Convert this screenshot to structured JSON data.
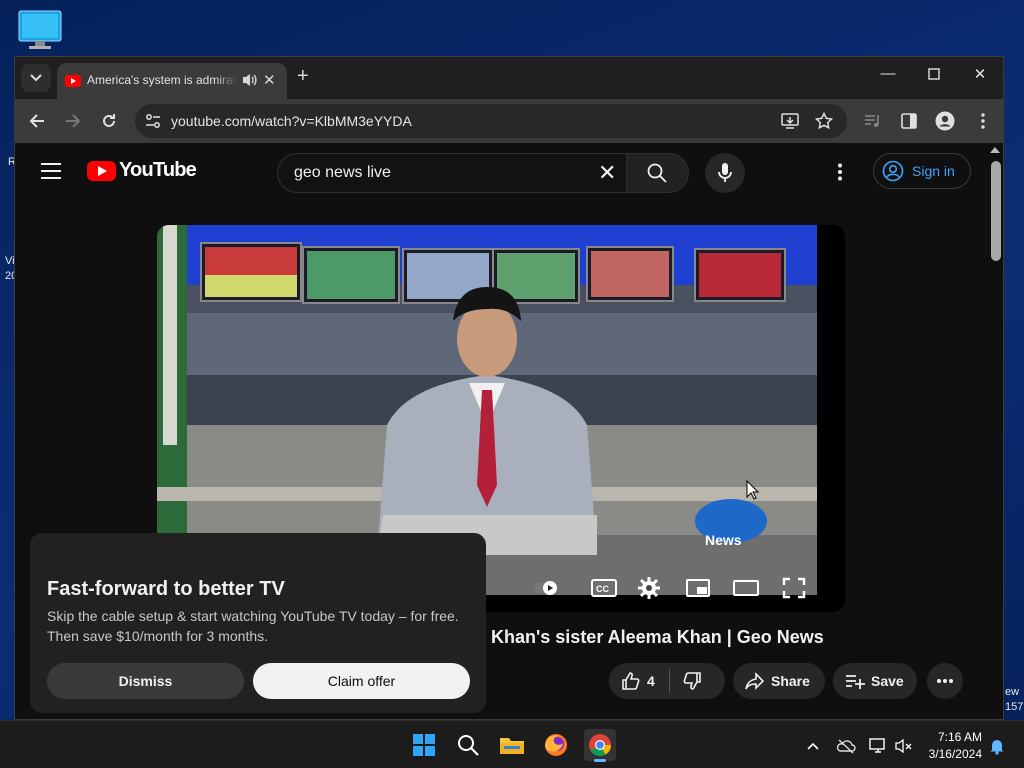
{
  "desktop": {
    "left_fragments": [
      "R",
      "Vi",
      "20"
    ],
    "right_fragments": [
      "ew",
      "157"
    ]
  },
  "browser": {
    "tab": {
      "title": "America's system is admiral"
    },
    "url": "youtube.com/watch?v=KlbMM3eYYDA",
    "colors": {
      "tabbar": "#1f1f1f",
      "toolbar": "#3b3b3b"
    }
  },
  "youtube": {
    "logo_text": "YouTube",
    "search": {
      "value": "geo news live"
    },
    "sign_in_label": "Sign in",
    "video": {
      "title_visible": "Khan's sister Aleema Khan | Geo News",
      "like_count": "4",
      "share_label": "Share",
      "save_label": "Save",
      "watermark": "News"
    },
    "promo": {
      "title": "Fast-forward to better TV",
      "body": "Skip the cable setup & start watching YouTube TV today – for free. Then save $10/month for 3 months.",
      "dismiss_label": "Dismiss",
      "claim_label": "Claim offer"
    },
    "colors": {
      "brand_red": "#ff0000",
      "link_blue": "#3ea6ff"
    }
  },
  "taskbar": {
    "time": "7:16 AM",
    "date": "3/16/2024"
  }
}
